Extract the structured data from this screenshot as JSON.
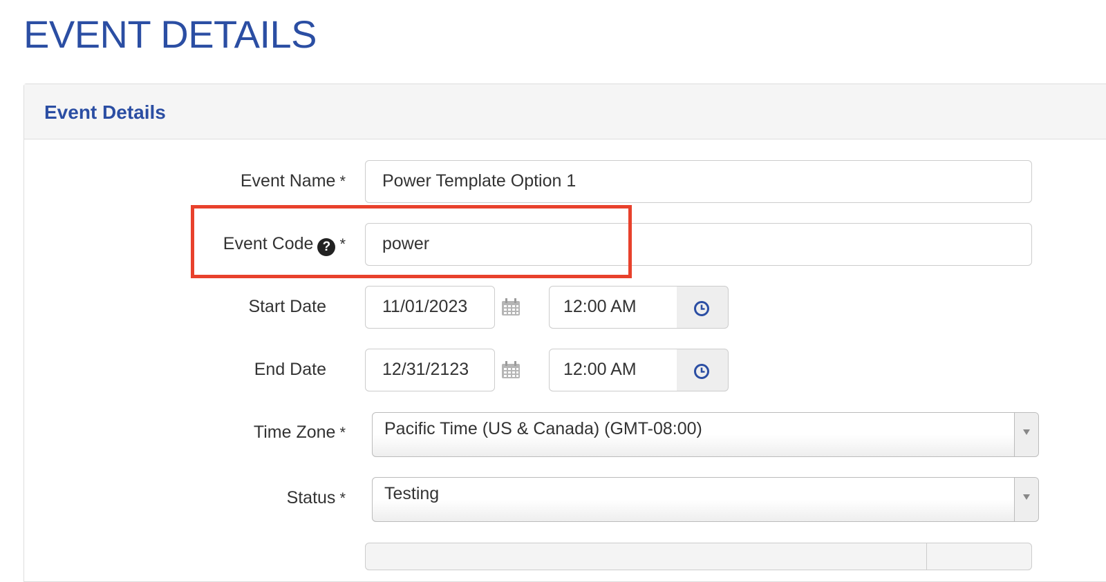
{
  "page": {
    "title": "EVENT DETAILS"
  },
  "panel": {
    "title": "Event Details"
  },
  "form": {
    "event_name": {
      "label": "Event Name",
      "required_mark": "*",
      "value": "Power Template Option 1"
    },
    "event_code": {
      "label": "Event Code",
      "help_icon_glyph": "?",
      "required_mark": "*",
      "value": "power",
      "highlighted": true,
      "highlight_color": "#e8412c"
    },
    "start_date": {
      "label": "Start Date",
      "date_value": "11/01/2023",
      "time_value": "12:00 AM",
      "date_icon": "calendar-icon",
      "time_icon": "clock-icon"
    },
    "end_date": {
      "label": "End Date",
      "date_value": "12/31/2123",
      "time_value": "12:00 AM",
      "date_icon": "calendar-icon",
      "time_icon": "clock-icon"
    },
    "time_zone": {
      "label": "Time Zone",
      "required_mark": "*",
      "selected": "Pacific Time (US & Canada) (GMT-08:00)"
    },
    "status": {
      "label": "Status",
      "required_mark": "*",
      "selected": "Testing"
    }
  },
  "colors": {
    "brand_blue": "#2b4ea3",
    "highlight_red": "#e8412c"
  }
}
